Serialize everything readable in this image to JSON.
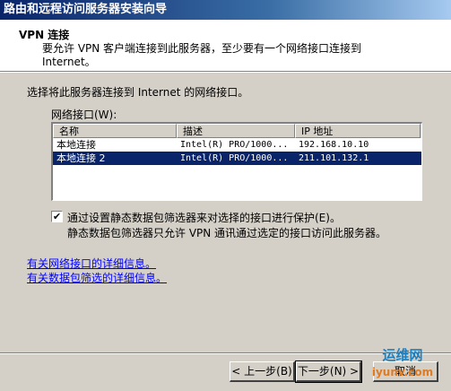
{
  "window": {
    "title": "路由和远程访问服务器安装向导"
  },
  "header": {
    "title": "VPN 连接",
    "description": "要允许 VPN 客户端连接到此服务器，至少要有一个网络接口连接到 Internet。"
  },
  "prompt": "选择将此服务器连接到 Internet 的网络接口。",
  "interfaces": {
    "label": "网络接口(W):",
    "columns": [
      "名称",
      "描述",
      "IP 地址"
    ],
    "rows": [
      {
        "name": "本地连接",
        "description": "Intel(R) PRO/1000...",
        "ip": "192.168.10.10",
        "selected": false
      },
      {
        "name": "本地连接 2",
        "description": "Intel(R) PRO/1000...",
        "ip": "211.101.132.1",
        "selected": true
      }
    ]
  },
  "filter_checkbox": {
    "checked": true,
    "label": "通过设置静态数据包筛选器来对选择的接口进行保护(E)。",
    "sublabel": "静态数据包筛选器只允许 VPN 通讯通过选定的接口访问此服务器。"
  },
  "links": {
    "interfaces_help": "有关网络接口的详细信息。",
    "filter_help": "有关数据包筛选的详细信息。"
  },
  "buttons": {
    "back": "< 上一步(B)",
    "next": "下一步(N) >",
    "cancel": "取消"
  },
  "watermark": {
    "logo": "运维网",
    "url": "iyunv.com"
  }
}
